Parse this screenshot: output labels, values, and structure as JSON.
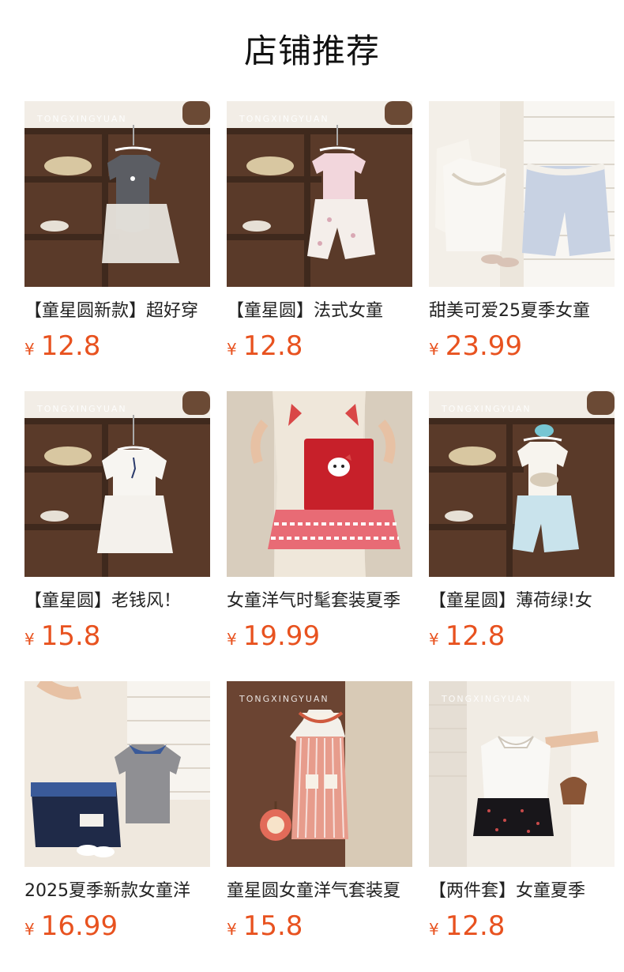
{
  "section": {
    "title": "店铺推荐"
  },
  "products": [
    {
      "name": "【童星圆新款】超好穿",
      "currency": "¥",
      "price": "12.8",
      "image": "gray-vest-and-white-shorts-on-hanger",
      "watermark": "TONGXINGYUAN"
    },
    {
      "name": "【童星圆】法式女童",
      "currency": "¥",
      "price": "12.8",
      "image": "pink-tee-and-floral-pants-on-hanger",
      "watermark": "TONGXINGYUAN"
    },
    {
      "name": "甜美可爱25夏季女童",
      "currency": "¥",
      "price": "23.99",
      "image": "white-lace-top-and-blue-floral-shorts",
      "watermark": ""
    },
    {
      "name": "【童星圆】老钱风！",
      "currency": "¥",
      "price": "15.8",
      "image": "white-cardigan-and-skirt-on-hanger",
      "watermark": "TONGXINGYUAN"
    },
    {
      "name": "女童洋气时髦套装夏季",
      "currency": "¥",
      "price": "19.99",
      "image": "red-gingham-kitty-top-held-up",
      "watermark": ""
    },
    {
      "name": "【童星圆】薄荷绿!女",
      "currency": "¥",
      "price": "12.8",
      "image": "white-tee-and-mint-shorts-on-hanger",
      "watermark": "TONGXINGYUAN"
    },
    {
      "name": "2025夏季新款女童洋",
      "currency": "¥",
      "price": "16.99",
      "image": "navy-skirt-and-gray-collar-top",
      "watermark": ""
    },
    {
      "name": "童星圆女童洋气套装夏",
      "currency": "¥",
      "price": "15.8",
      "image": "pink-striped-set-with-apple-bag",
      "watermark": "TONGXINGYUAN"
    },
    {
      "name": "【两件套】女童夏季",
      "currency": "¥",
      "price": "12.8",
      "image": "white-shirt-and-black-dotted-skirt",
      "watermark": "TONGXINGYUAN"
    }
  ],
  "colors": {
    "price": "#e8521f",
    "name": "#222222",
    "title": "#111111"
  }
}
